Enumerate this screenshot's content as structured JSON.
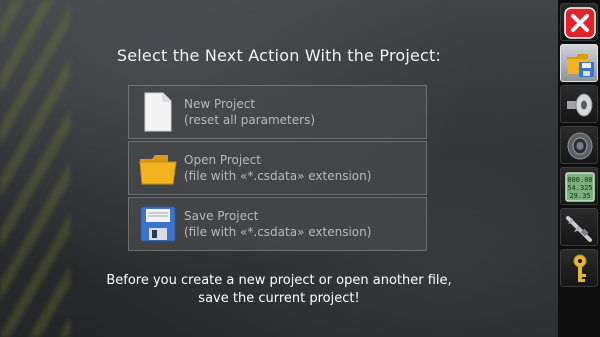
{
  "dialog": {
    "title": "Select the Next Action With the Project:",
    "actions": [
      {
        "name": "New Project",
        "description": "(reset all parameters)",
        "icon": "blank-document-icon"
      },
      {
        "name": "Open Project",
        "description": "(file with «*.csdata» extension)",
        "icon": "folder-icon"
      },
      {
        "name": "Save Project",
        "description": "(file with «*.csdata» extension)",
        "icon": "floppy-disk-icon"
      }
    ],
    "note_line1": "Before you create a new project or open another file,",
    "note_line2": "save the current project!"
  },
  "sidebar": {
    "buttons": [
      {
        "icon": "close-icon",
        "active": false
      },
      {
        "icon": "file-folder-icon",
        "active": true
      },
      {
        "icon": "cylinder-tool-icon",
        "active": false
      },
      {
        "icon": "bearing-icon",
        "active": false
      },
      {
        "icon": "calculator-display-icon",
        "active": false,
        "display_lines": [
          "000.00",
          "54.325",
          "29.35"
        ]
      },
      {
        "icon": "caliper-icon",
        "active": false
      },
      {
        "icon": "key-icon",
        "active": false
      }
    ]
  },
  "colors": {
    "close_red": "#e0232a",
    "folder_yellow": "#f3b21f",
    "floppy_blue": "#3d73c8",
    "key_gold": "#e3b53a"
  }
}
